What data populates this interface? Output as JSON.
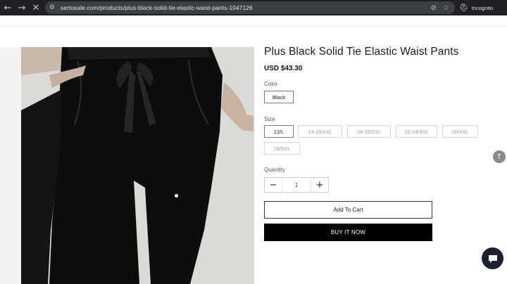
{
  "browser": {
    "back_icon": "←",
    "forward_icon": "→",
    "reload_icon": "✕",
    "site_icon": "⚙",
    "url": "sertosale.com/products/plus-black-solid-tie-elastic-waist-pants-1047126",
    "eye_off_icon": "⊘",
    "star_icon": "☆",
    "incognito_icon": "⛑",
    "incognito_label": "Incognito"
  },
  "product": {
    "title": "Plus Black Solid Tie Elastic Waist Pants",
    "price": "USD $43.30",
    "color_label": "Color",
    "colors": [
      "Black"
    ],
    "size_label": "Size",
    "sizes": [
      "12/L",
      "14-16/1XL",
      "18-20/2XL",
      "22-24/3XL",
      "26/4XL",
      "28/5XL"
    ],
    "selected_size": "12/L",
    "quantity_label": "Quantity",
    "quantity": "1",
    "minus_icon": "−",
    "plus_icon": "+",
    "add_to_cart": "Add To Cart",
    "buy_now": "BUY IT NOW"
  },
  "widgets": {
    "back_to_top_icon": "↑",
    "chat_icon": "chat-bubble"
  }
}
